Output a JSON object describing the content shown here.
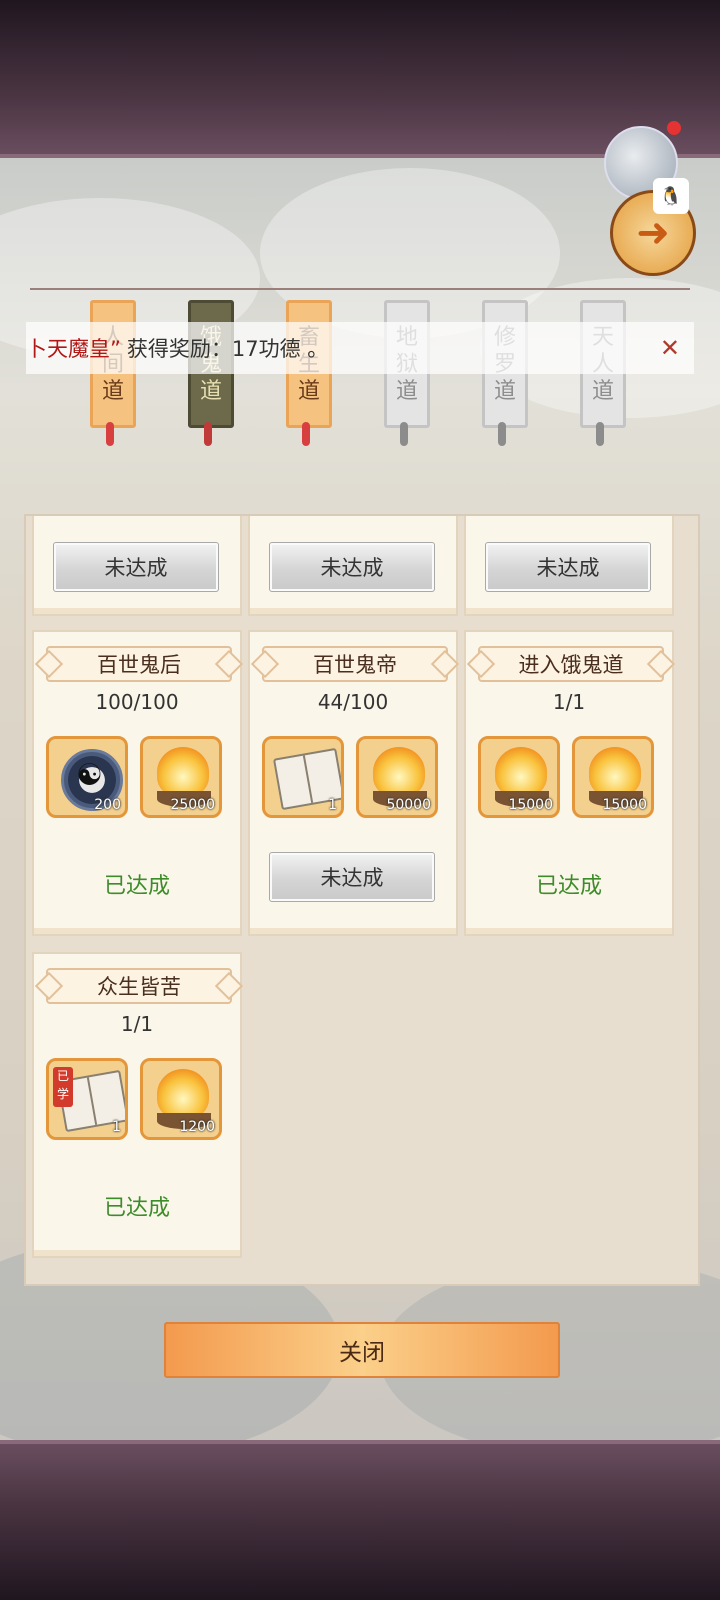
{
  "notice": {
    "prefix": "卜天魔皇”",
    "message": "获得奖励：17功德 。"
  },
  "realm_tabs": [
    {
      "label": "人\n间\n道",
      "state": "unlocked"
    },
    {
      "label": "饿\n鬼\n道",
      "state": "selected"
    },
    {
      "label": "畜\n生\n道",
      "state": "unlocked"
    },
    {
      "label": "地\n狱\n道",
      "state": "locked"
    },
    {
      "label": "修\n罗\n道",
      "state": "locked"
    },
    {
      "label": "天\n人\n道",
      "state": "locked"
    }
  ],
  "top_cards": [
    {
      "status": "未达成"
    },
    {
      "status": "未达成"
    },
    {
      "status": "未达成"
    }
  ],
  "achievements": [
    {
      "title": "百世鬼后",
      "progress": "100/100",
      "rewards": [
        {
          "icon": "taiji-compass-icon",
          "count": "200"
        },
        {
          "icon": "flame-bowl-icon",
          "count": "25000"
        }
      ],
      "status": "已达成"
    },
    {
      "title": "百世鬼帝",
      "progress": "44/100",
      "rewards": [
        {
          "icon": "book-icon",
          "count": "1"
        },
        {
          "icon": "flame-bowl-icon",
          "count": "50000"
        }
      ],
      "status": "未达成"
    },
    {
      "title": "进入饿鬼道",
      "progress": "1/1",
      "rewards": [
        {
          "icon": "flame-bowl-icon",
          "count": "15000"
        },
        {
          "icon": "flame-bowl-icon",
          "count": "15000"
        }
      ],
      "status": "已达成"
    },
    {
      "title": "众生皆苦",
      "progress": "1/1",
      "rewards": [
        {
          "icon": "book-icon",
          "count": "1",
          "badge": "已学"
        },
        {
          "icon": "flame-bowl-icon",
          "count": "1200"
        }
      ],
      "status": "已达成"
    }
  ],
  "close_button": "关闭",
  "colors": {
    "done": "#3d8c2a",
    "accent": "#e4963a",
    "notice_name": "#b01818"
  }
}
